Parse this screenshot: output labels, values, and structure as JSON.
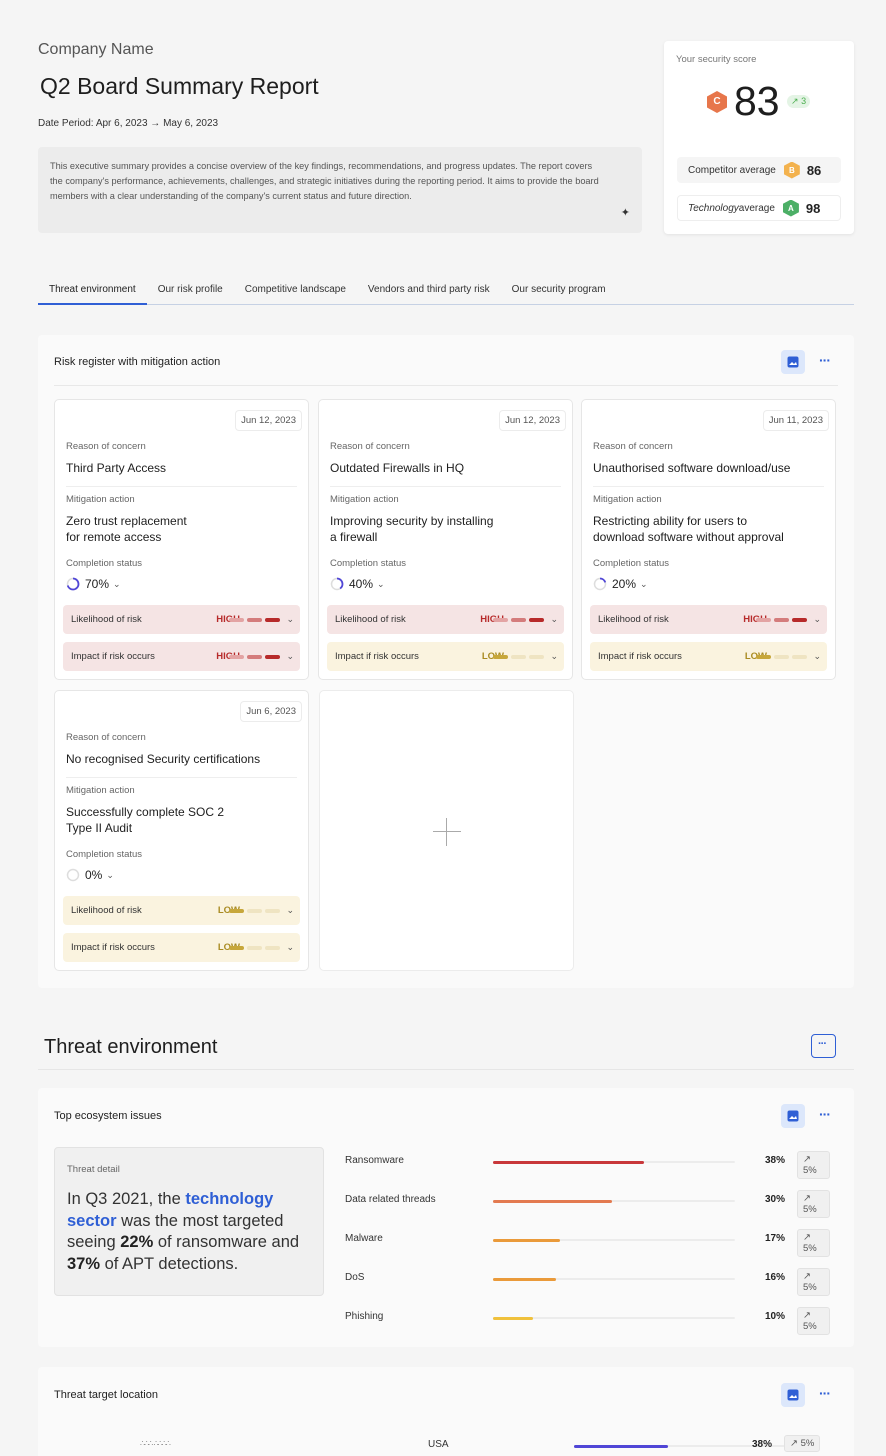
{
  "header": {
    "company": "Company Name",
    "title": "Q2 Board Summary Report",
    "period": "Date Period: Apr 6, 2023 → May 6, 2023",
    "summary": "This executive summary provides a concise overview of the key findings, recommendations, and progress updates. The report covers the company's performance, achievements, challenges, and strategic initiatives during the reporting period. It aims to provide the board members with a clear understanding of the company's current status and future direction."
  },
  "score": {
    "label": "Your security score",
    "grade": "C",
    "value": "83",
    "trend_arrow": "↗",
    "trend": "3",
    "competitor_label": "Competitor average",
    "competitor_grade": "B",
    "competitor_value": "86",
    "industry_italic": "Technology",
    "industry_label": " average",
    "industry_grade": "A",
    "industry_value": "98"
  },
  "tabs": [
    "Threat environment",
    "Our risk profile",
    "Competitive landscape",
    "Vendors and third party risk",
    "Our security program"
  ],
  "risk_register": {
    "title": "Risk register with mitigation action",
    "reason_label": "Reason of concern",
    "mitigation_label": "Mitigation action",
    "completion_label": "Completion status",
    "likelihood_label": "Likelihood of risk",
    "impact_label": "Impact if risk occurs",
    "cards": [
      {
        "date": "Jun 12, 2023",
        "reason": "Third Party Access",
        "mitigation": "Zero trust replacement\nfor remote access",
        "completion": 0.7,
        "completion_text": "70%",
        "likelihood": "HIGH",
        "impact": "HIGH"
      },
      {
        "date": "Jun 12, 2023",
        "reason": "Outdated Firewalls in HQ",
        "mitigation": "Improving security by installing\na firewall",
        "completion": 0.4,
        "completion_text": "40%",
        "likelihood": "HIGH",
        "impact": "LOW"
      },
      {
        "date": "Jun 11, 2023",
        "reason": "Unauthorised software download/use",
        "mitigation": "Restricting ability for users to\ndownload software without approval",
        "completion": 0.2,
        "completion_text": "20%",
        "likelihood": "HIGH",
        "impact": "LOW"
      },
      {
        "date": "Jun 6, 2023",
        "reason": "No recognised Security certifications",
        "mitigation": "Successfully complete SOC 2\nType II Audit",
        "completion": 0.0,
        "completion_text": "0%",
        "likelihood": "LOW",
        "impact": "LOW"
      }
    ]
  },
  "threat_env": {
    "title": "Threat environment"
  },
  "ecosystem": {
    "title": "Top ecosystem issues",
    "detail_label": "Threat detail",
    "detail_pre": "In Q3 2021, the ",
    "detail_hl": "technology sector",
    "detail_mid1": " was the most targeted seeing ",
    "detail_b1": "22%",
    "detail_mid2": " of ransomware and ",
    "detail_b2": "37%",
    "detail_post": " of APT detections.",
    "issues": [
      {
        "name": "Ransomware",
        "value": 38,
        "pct": "38%",
        "trend": "↗ 5%",
        "color": "#c8373a"
      },
      {
        "name": "Data related threads",
        "value": 30,
        "pct": "30%",
        "trend": "↗ 5%",
        "color": "#e37a50"
      },
      {
        "name": "Malware",
        "value": 17,
        "pct": "17%",
        "trend": "↗ 5%",
        "color": "#ea9a3a"
      },
      {
        "name": "DoS",
        "value": 16,
        "pct": "16%",
        "trend": "↗ 5%",
        "color": "#ea9a3a"
      },
      {
        "name": "Phishing",
        "value": 10,
        "pct": "10%",
        "trend": "↗ 5%",
        "color": "#f0c13c"
      }
    ]
  },
  "location": {
    "title": "Threat target location",
    "rows": [
      {
        "name": "USA",
        "value": 38,
        "pct": "38%",
        "trend": "↗ 5%",
        "color": "#5046d6"
      }
    ]
  },
  "colors": {
    "accent": "#2f5fd5",
    "high": "#b72a2a",
    "low": "#a98b22"
  }
}
